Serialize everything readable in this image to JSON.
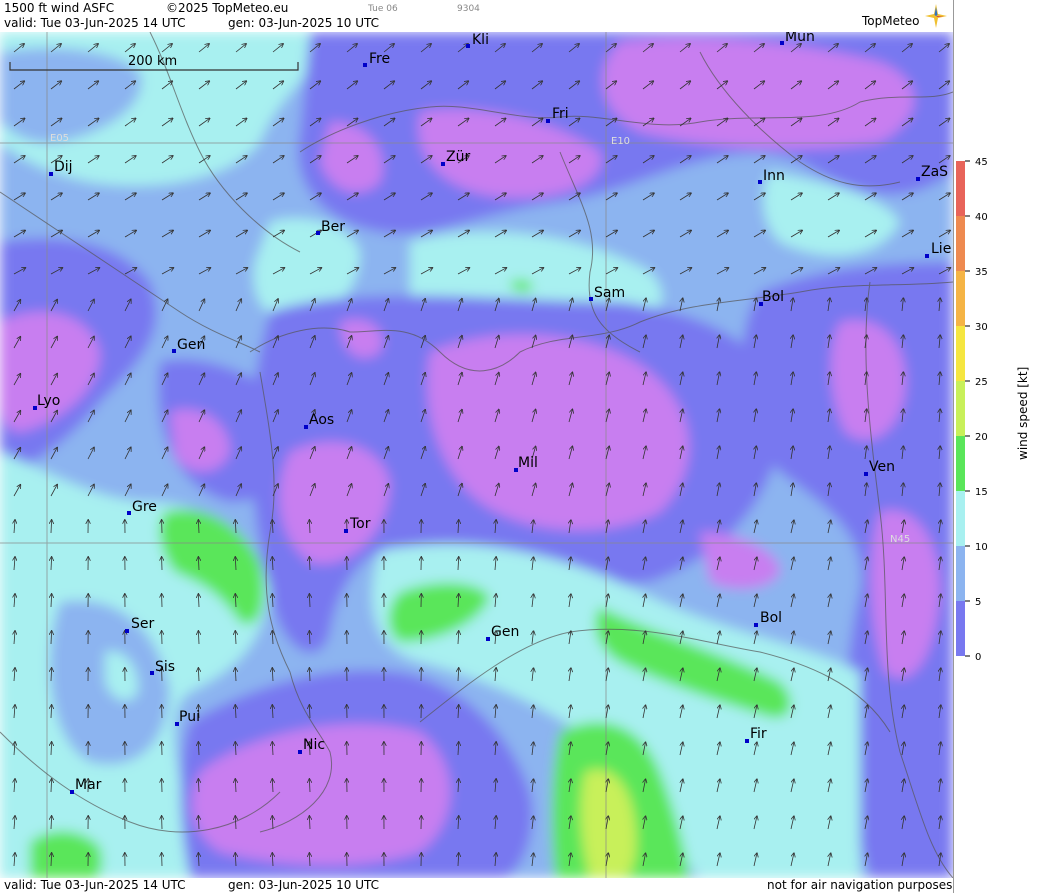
{
  "header": {
    "product": "1500 ft wind ASFC",
    "copyright": "©2025 TopMeteo.eu",
    "tab_small": "Tue 06",
    "code_small": "9304",
    "valid": "valid:  Tue  03-Jun-2025  14 UTC",
    "generated": "gen: 03-Jun-2025 10 UTC",
    "logo": "TopMeteo"
  },
  "footer": {
    "valid": "valid:  Tue  03-Jun-2025  14 UTC",
    "generated": "gen: 03-Jun-2025 10 UTC",
    "disclaimer": "not for air navigation purposes"
  },
  "scale_bar": {
    "label": "200 km"
  },
  "grid_labels": {
    "lon_west": "E05",
    "lon_east": "E10",
    "lat": "N45"
  },
  "cities": [
    {
      "name": "Kli"
    },
    {
      "name": "Mün"
    },
    {
      "name": "Fre"
    },
    {
      "name": "Fri"
    },
    {
      "name": "Dij"
    },
    {
      "name": "Zür"
    },
    {
      "name": "Inn"
    },
    {
      "name": "ZaS"
    },
    {
      "name": "Ber"
    },
    {
      "name": "Lie"
    },
    {
      "name": "Sam"
    },
    {
      "name": "Bol"
    },
    {
      "name": "Gen"
    },
    {
      "name": "Lyo"
    },
    {
      "name": "Aos"
    },
    {
      "name": "Mil"
    },
    {
      "name": "Ven"
    },
    {
      "name": "Gre"
    },
    {
      "name": "Tor"
    },
    {
      "name": "Ser"
    },
    {
      "name": "Gen"
    },
    {
      "name": "Bol"
    },
    {
      "name": "Sis"
    },
    {
      "name": "Pui"
    },
    {
      "name": "Nic"
    },
    {
      "name": "Fir"
    },
    {
      "name": "Mar"
    }
  ],
  "legend": {
    "title": "wind speed [kt]",
    "ticks": [
      "45",
      "40",
      "35",
      "30",
      "25",
      "20",
      "15",
      "10",
      "5",
      "0"
    ],
    "colors": [
      "#e8645a",
      "#ee8a50",
      "#f5b445",
      "#f5e640",
      "#c8f05a",
      "#5ae65a",
      "#a8f0f0",
      "#8cb4f0",
      "#7878f0",
      "#c87ef0"
    ]
  },
  "colors": {
    "band_0_5": "#c87ef0",
    "band_5_10": "#7878f0",
    "band_10_15": "#8cb4f0",
    "band_15_20": "#a8f0f0",
    "band_20_25": "#5ae65a",
    "band_25_30": "#c8f05a",
    "city": "#0000c8"
  }
}
